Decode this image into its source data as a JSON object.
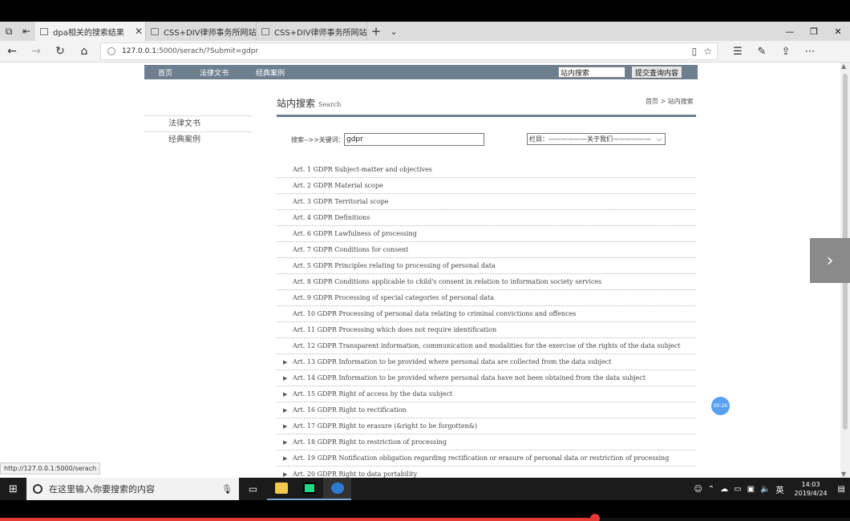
{
  "browser": {
    "tabs": [
      {
        "title": "dpa相关的搜索结果",
        "active": true
      },
      {
        "title": "CSS+DIV律师事务所网站全",
        "active": false
      },
      {
        "title": "CSS+DIV律师事务所网站全",
        "active": false
      }
    ],
    "new_tab": "+",
    "url_host": "127.0.0.1",
    "url_rest": ":5000/serach/?Submit=gdpr",
    "status_url": "http://127.0.0.1:5000/serach"
  },
  "site": {
    "topnav": [
      "首页",
      "法律文书",
      "经典案例"
    ],
    "search_value": "站内搜索",
    "search_submit": "提交查询内容",
    "sidebar": [
      "法律文书",
      "经典案例"
    ],
    "title": "站内搜索",
    "title_en": "Search",
    "breadcrumb": "首页 > 站内搜索",
    "keyword_label": "搜索-->>关键词：",
    "keyword_value": "gdpr",
    "column_select": "栏目：——————关于我们——————"
  },
  "results": [
    {
      "text": "Art. 1 GDPR Subject-matter and objectives",
      "expand": false
    },
    {
      "text": "Art. 2 GDPR Material scope",
      "expand": false
    },
    {
      "text": "Art. 3 GDPR Territorial scope",
      "expand": false
    },
    {
      "text": "Art. 4 GDPR Definitions",
      "expand": false
    },
    {
      "text": "Art. 6 GDPR Lawfulness of processing",
      "expand": false
    },
    {
      "text": "Art. 7 GDPR Conditions for consent",
      "expand": false
    },
    {
      "text": "Art. 5 GDPR Principles relating to processing of personal data",
      "expand": false
    },
    {
      "text": "Art. 8 GDPR Conditions applicable to child's consent in relation to information society services",
      "expand": false
    },
    {
      "text": "Art. 9 GDPR Processing of special categories of personal data",
      "expand": false
    },
    {
      "text": "Art. 10 GDPR Processing of personal data relating to criminal convictions and offences",
      "expand": false
    },
    {
      "text": "Art. 11 GDPR Processing which does not require identification",
      "expand": false
    },
    {
      "text": "Art. 12 GDPR Transparent information, communication and modalities for the exercise of the rights of the data subject",
      "expand": false
    },
    {
      "text": "Art. 13 GDPR Information to be provided where personal data are collected from the data subject",
      "expand": true
    },
    {
      "text": "Art. 14 GDPR Information to be provided where personal data have not been obtained from the data subject",
      "expand": true
    },
    {
      "text": "Art. 15 GDPR Right of access by the data subject",
      "expand": true
    },
    {
      "text": "Art. 16 GDPR Right to rectification",
      "expand": true
    },
    {
      "text": "Art. 17 GDPR Right to erasure (&right to be forgotten&)",
      "expand": true
    },
    {
      "text": "Art. 18 GDPR Right to restriction of processing",
      "expand": true
    },
    {
      "text": "Art. 19 GDPR Notification obligation regarding rectification or erasure of personal data or restriction of processing",
      "expand": true
    },
    {
      "text": "Art. 20 GDPR Right to data portability",
      "expand": true
    }
  ],
  "overlay": {
    "timer": "00:26"
  },
  "taskbar": {
    "search_placeholder": "在这里输入你要搜索的内容",
    "ime": "英",
    "time": "14:03",
    "date": "2019/4/24"
  },
  "video_progress": 0.7
}
